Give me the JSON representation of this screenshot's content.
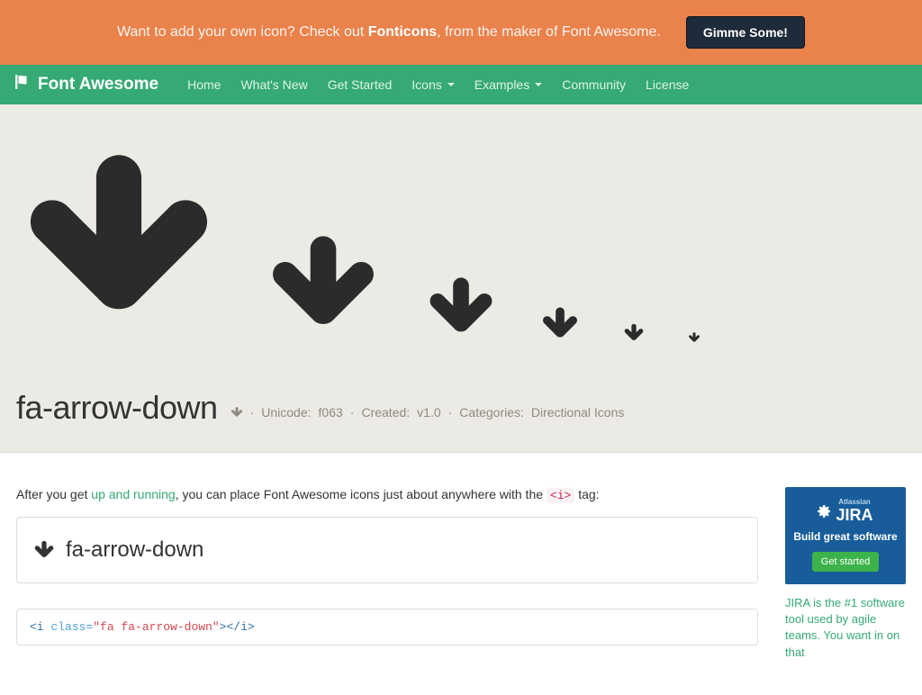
{
  "promo": {
    "prefix": "Want to add your own icon? Check out ",
    "brand": "Fonticons",
    "suffix": ", from the maker of Font Awesome.",
    "button": "Gimme Some!"
  },
  "nav": {
    "brand": "Font Awesome",
    "items": [
      "Home",
      "What's New",
      "Get Started",
      "Icons",
      "Examples",
      "Community",
      "License"
    ],
    "dropdowns": [
      3,
      4
    ]
  },
  "icon": {
    "name": "fa-arrow-down",
    "unicode": "f063",
    "created": "v1.0",
    "categories": "Directional Icons",
    "meta_label_unicode": "Unicode:",
    "meta_label_created": "Created:",
    "meta_label_categories": "Categories:"
  },
  "intro": {
    "prefix": "After you get ",
    "link": "up and running",
    "mid": ", you can place Font Awesome icons just about anywhere with the ",
    "code": "<i>",
    "suffix": " tag:"
  },
  "example": {
    "label": "fa-arrow-down",
    "code_html": "<i class=\"fa fa-arrow-down\"></i>"
  },
  "ad": {
    "super": "Atlassian",
    "logo": "JIRA",
    "tagline": "Build great software",
    "cta": "Get started",
    "blurb": "JIRA is the #1 software tool used by agile teams. You want in on that"
  }
}
